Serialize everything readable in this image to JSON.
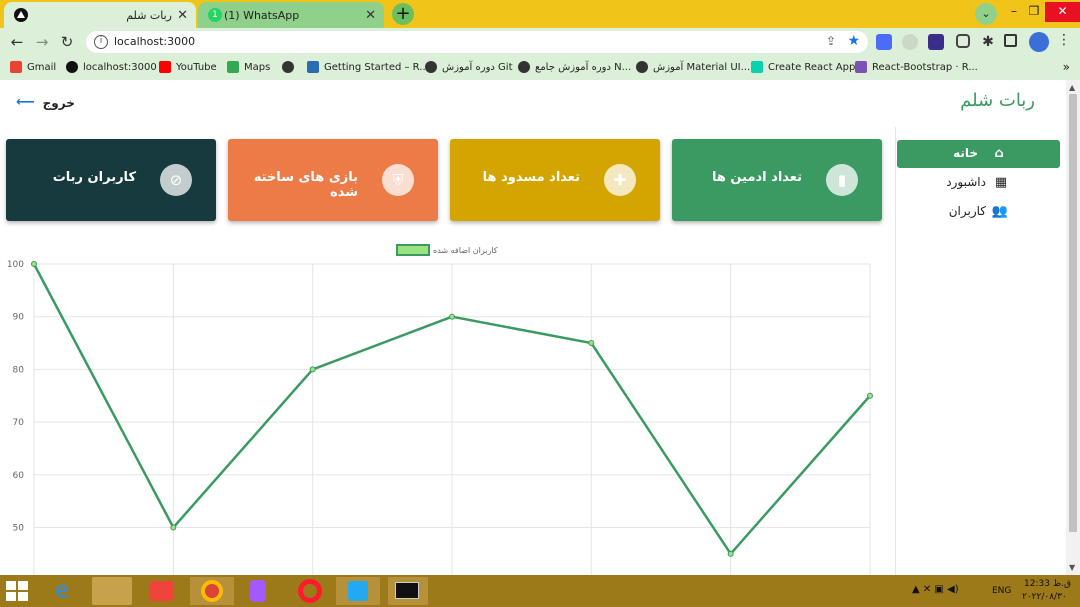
{
  "browser": {
    "tabs": [
      {
        "title": "ربات شلم",
        "active": true
      },
      {
        "title": "(1) WhatsApp",
        "active": false
      }
    ],
    "url": "localhost:3000",
    "bookmarks": [
      "Gmail",
      "localhost:3000",
      "YouTube",
      "Maps",
      "Getting Started – R...",
      "دوره آموزش Git",
      "دوره آموزش جامع N...",
      "آموزش Material UI...",
      "Create React App",
      "React-Bootstrap · R..."
    ],
    "whatsapp_badge": "1"
  },
  "app": {
    "brand": "ربات شلم",
    "logout_label": "خروج",
    "cards": [
      {
        "title": "تعداد ادمین ها",
        "color": "#3a9a62",
        "icon": "bar-chart-icon"
      },
      {
        "title": "تعداد مسدود ها",
        "color": "#d4a500",
        "icon": "puzzle-icon"
      },
      {
        "title": "بازی های ساخته شده",
        "color": "#ec7b47",
        "icon": "shield-icon"
      },
      {
        "title": "کاربران ربات",
        "color": "#163a3d",
        "icon": "block-icon"
      }
    ],
    "sidebar": [
      {
        "label": "خانه",
        "icon": "home-icon",
        "active": true
      },
      {
        "label": "داشبورد",
        "icon": "grid-icon",
        "active": false
      },
      {
        "label": "کاربران",
        "icon": "users-icon",
        "active": false
      }
    ]
  },
  "chart_data": {
    "type": "line",
    "series": [
      {
        "name": "کاربران اضافه شده",
        "values": [
          100,
          50,
          80,
          90,
          85,
          45,
          75
        ],
        "color": "#3a9a62"
      }
    ],
    "y_ticks": [
      100,
      90,
      80,
      70,
      60,
      50
    ],
    "ylim": [
      40,
      100
    ],
    "grid": true,
    "legend_position": "top"
  },
  "taskbar": {
    "lang": "ENG",
    "time": "12:33 ق.ظ",
    "date": "۲۰۲۲/۰۸/۳۰"
  }
}
